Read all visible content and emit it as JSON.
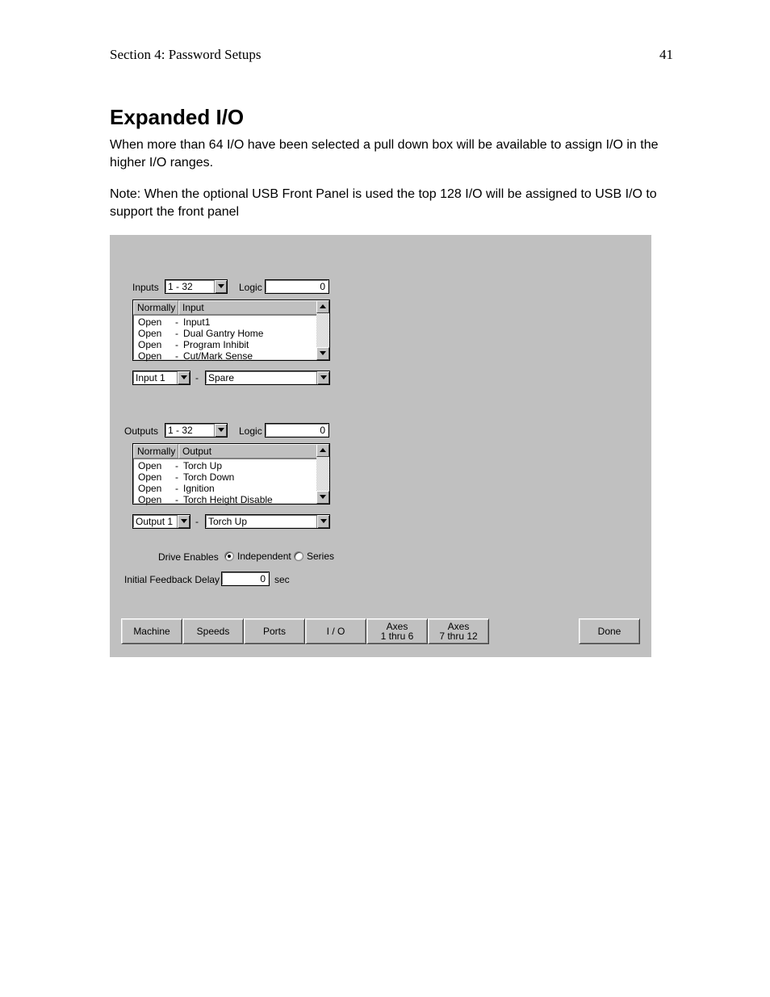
{
  "header": {
    "section": "Section 4: Password Setups",
    "page": "41"
  },
  "heading": "Expanded I/O",
  "para1": "When more than 64 I/O have been selected a pull down box will be available to assign I/O in the higher I/O ranges.",
  "para2": "Note: When the optional USB Front Panel is used the top 128 I/O will be assigned to USB I/O to support the front panel",
  "inputs": {
    "label": "Inputs",
    "range": "1 - 32",
    "logic_label": "Logic",
    "logic_value": "0",
    "headers": {
      "normally": "Normally",
      "input": "Input"
    },
    "rows": [
      {
        "state": "Open",
        "name": "Input1"
      },
      {
        "state": "Open",
        "name": "Dual Gantry Home"
      },
      {
        "state": "Open",
        "name": "Program Inhibit"
      },
      {
        "state": "Open",
        "name": "Cut/Mark Sense"
      }
    ],
    "map_src": "Input 1",
    "map_dst": "Spare"
  },
  "outputs": {
    "label": "Outputs",
    "range": "1 - 32",
    "logic_label": "Logic",
    "logic_value": "0",
    "headers": {
      "normally": "Normally",
      "output": "Output"
    },
    "rows": [
      {
        "state": "Open",
        "name": "Torch Up"
      },
      {
        "state": "Open",
        "name": "Torch Down"
      },
      {
        "state": "Open",
        "name": "Ignition"
      },
      {
        "state": "Open",
        "name": "Torch Height Disable"
      }
    ],
    "map_src": "Output 1",
    "map_dst": "Torch Up"
  },
  "drive": {
    "label": "Drive Enables",
    "opt_ind": "Independent",
    "opt_ser": "Series",
    "selected": "Independent"
  },
  "feedback": {
    "label": "Initial Feedback Delay",
    "value": "0",
    "unit": "sec"
  },
  "buttons": {
    "machine": "Machine",
    "speeds": "Speeds",
    "ports": "Ports",
    "io": "I / O",
    "axes16": "Axes\n1 thru 6",
    "axes712": "Axes\n7 thru 12",
    "done": "Done"
  }
}
